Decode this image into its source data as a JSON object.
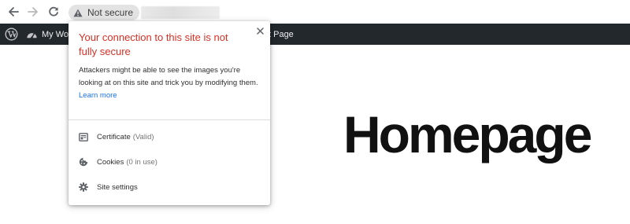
{
  "toolbar": {
    "back_icon": "arrow-left-icon",
    "forward_icon": "arrow-right-icon",
    "reload_icon": "reload-icon",
    "security_chip": {
      "icon": "warning-triangle-icon",
      "label": "Not secure"
    }
  },
  "adminbar": {
    "logo_icon": "wordpress-logo-icon",
    "my_site": {
      "icon": "dashboard-gauge-icon",
      "label": "My Wo"
    },
    "edit_page_label": "t Page"
  },
  "page": {
    "heading": "Homepage"
  },
  "popup": {
    "close_icon": "close-icon",
    "title": "Your connection to this site is not fully secure",
    "description": "Attackers might be able to see the images you're looking at on this site and trick you by modifying them.",
    "learn_more": "Learn more",
    "rows": [
      {
        "icon": "certificate-icon",
        "label": "Certificate",
        "detail": "(Valid)"
      },
      {
        "icon": "cookie-icon",
        "label": "Cookies",
        "detail": "(0 in use)"
      },
      {
        "icon": "gear-icon",
        "label": "Site settings",
        "detail": ""
      }
    ]
  },
  "colors": {
    "warning_title": "#d93025",
    "link": "#1a73e8",
    "adminbar_bg": "#23282d",
    "chip_bg": "#e3e3e3"
  }
}
